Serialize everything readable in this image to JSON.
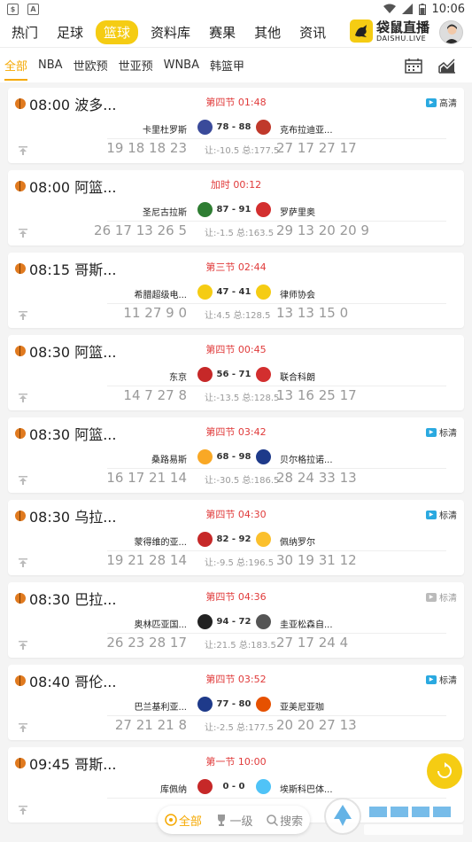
{
  "statusbar": {
    "time": "10:06"
  },
  "brand": {
    "name": "袋鼠直播",
    "sub": "DAISHU.LIVE"
  },
  "topnav": {
    "tabs": [
      {
        "label": "热门"
      },
      {
        "label": "足球"
      },
      {
        "label": "篮球"
      },
      {
        "label": "资料库"
      },
      {
        "label": "赛果"
      },
      {
        "label": "其他"
      },
      {
        "label": "资讯"
      }
    ],
    "active": "篮球"
  },
  "subnav": {
    "tabs": [
      {
        "label": "全部"
      },
      {
        "label": "NBA"
      },
      {
        "label": "世欧预"
      },
      {
        "label": "世亚预"
      },
      {
        "label": "WNBA"
      },
      {
        "label": "韩篮甲"
      }
    ],
    "active": "全部"
  },
  "matches": [
    {
      "title": "08:00 波多...",
      "status": "第四节 01:48",
      "badge": "高清",
      "badge_style": "blue",
      "home": "卡里杜罗斯",
      "away": "克布拉迪亚...",
      "score": "78 - 88",
      "home_q": "19 18 18 23",
      "away_q": "27 17 27 17",
      "odds": "让:-10.5 总:177.5",
      "home_color": "#3a4a9a",
      "away_color": "#c0392b"
    },
    {
      "title": "08:00 阿篮...",
      "status": "加时 00:12",
      "badge": "",
      "badge_style": "",
      "home": "圣尼古拉斯",
      "away": "罗萨里奥",
      "score": "87 - 91",
      "home_q": "26 17 13 26 5",
      "away_q": "29 13 20 20 9",
      "odds": "让:-1.5 总:163.5",
      "home_color": "#2e7d32",
      "away_color": "#d32f2f"
    },
    {
      "title": "08:15 哥斯...",
      "status": "第三节 02:44",
      "badge": "",
      "badge_style": "",
      "home": "希腊超级电...",
      "away": "律师协会",
      "score": "47 - 41",
      "home_q": "11 27 9 0",
      "away_q": "13 13 15 0",
      "odds": "让:4.5 总:128.5",
      "home_color": "#f5cc13",
      "away_color": "#f5cc13"
    },
    {
      "title": "08:30 阿篮...",
      "status": "第四节 00:45",
      "badge": "",
      "badge_style": "",
      "home": "东京",
      "away": "联合科朗",
      "score": "56 - 71",
      "home_q": "14 7 27 8",
      "away_q": "13 16 25 17",
      "odds": "让:-13.5 总:128.5",
      "home_color": "#c62828",
      "away_color": "#d32f2f"
    },
    {
      "title": "08:30 阿篮...",
      "status": "第四节 03:42",
      "badge": "标清",
      "badge_style": "blue",
      "home": "桑路易斯",
      "away": "贝尔格拉诺...",
      "score": "68 - 98",
      "home_q": "16 17 21 14",
      "away_q": "28 24 33 13",
      "odds": "让:-30.5 总:186.5",
      "home_color": "#f9a825",
      "away_color": "#1e3a8a"
    },
    {
      "title": "08:30 乌拉...",
      "status": "第四节 04:30",
      "badge": "标清",
      "badge_style": "blue",
      "home": "蒙得维的亚...",
      "away": "佩纳罗尔",
      "score": "82 - 92",
      "home_q": "19 21 28 14",
      "away_q": "30 19 31 12",
      "odds": "让:-9.5 总:196.5",
      "home_color": "#c62828",
      "away_color": "#fbc02d"
    },
    {
      "title": "08:30 巴拉...",
      "status": "第四节 04:36",
      "badge": "标清",
      "badge_style": "grey",
      "home": "奥林匹亚国...",
      "away": "圭亚松森自...",
      "score": "94 - 72",
      "home_q": "26 23 28 17",
      "away_q": "27 17 24 4",
      "odds": "让:21.5 总:183.5",
      "home_color": "#222222",
      "away_color": "#555555"
    },
    {
      "title": "08:40 哥伦...",
      "status": "第四节 03:52",
      "badge": "标清",
      "badge_style": "blue",
      "home": "巴兰基利亚...",
      "away": "亚美尼亚咖",
      "score": "77 - 80",
      "home_q": "27 21 21 8",
      "away_q": "20 20 27 13",
      "odds": "让:-2.5 总:177.5",
      "home_color": "#1e3a8a",
      "away_color": "#e65100"
    },
    {
      "title": "09:45 哥斯...",
      "status": "第一节 10:00",
      "badge": "",
      "badge_style": "",
      "home": "库佩纳",
      "away": "埃斯科巴体...",
      "score": "0 - 0",
      "home_q": "",
      "away_q": "",
      "odds": "",
      "home_color": "#c62828",
      "away_color": "#4fc3f7"
    }
  ],
  "floatbar": {
    "items": [
      {
        "label": "全部"
      },
      {
        "label": "一级"
      },
      {
        "label": "搜索"
      }
    ]
  },
  "colors": {
    "accent": "#f5cc13",
    "live_red": "#e03a3a",
    "hd_blue": "#2aa9e0"
  }
}
